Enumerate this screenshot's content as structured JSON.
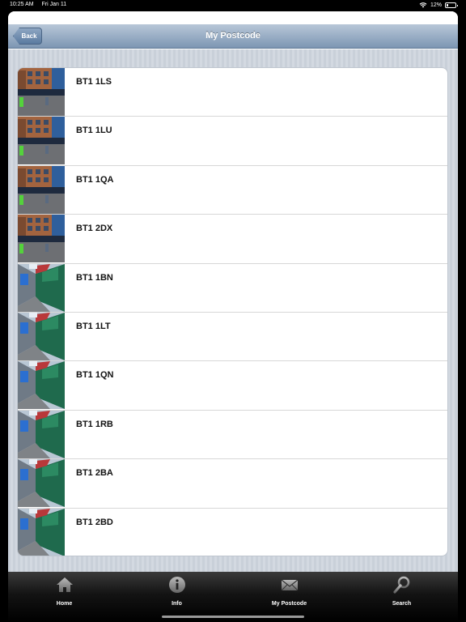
{
  "status_bar": {
    "time": "10:25 AM",
    "date": "Fri Jan 11",
    "battery": "12%"
  },
  "nav": {
    "back_label": "Back",
    "title": "My Postcode"
  },
  "postcodes": [
    {
      "label": "BT1 1LS",
      "thumb": "building"
    },
    {
      "label": "BT1 1LU",
      "thumb": "building"
    },
    {
      "label": "BT1 1QA",
      "thumb": "building"
    },
    {
      "label": "BT1 2DX",
      "thumb": "building"
    },
    {
      "label": "BT1 1BN",
      "thumb": "street"
    },
    {
      "label": "BT1 1LT",
      "thumb": "street"
    },
    {
      "label": "BT1 1QN",
      "thumb": "street"
    },
    {
      "label": "BT1 1RB",
      "thumb": "street"
    },
    {
      "label": "BT1 2BA",
      "thumb": "street"
    },
    {
      "label": "BT1 2BD",
      "thumb": "street"
    }
  ],
  "tabs": [
    {
      "label": "Home",
      "icon": "house-icon"
    },
    {
      "label": "Info",
      "icon": "info-icon"
    },
    {
      "label": "My Postcode",
      "icon": "envelope-icon"
    },
    {
      "label": "Search",
      "icon": "magnifier-icon"
    }
  ]
}
